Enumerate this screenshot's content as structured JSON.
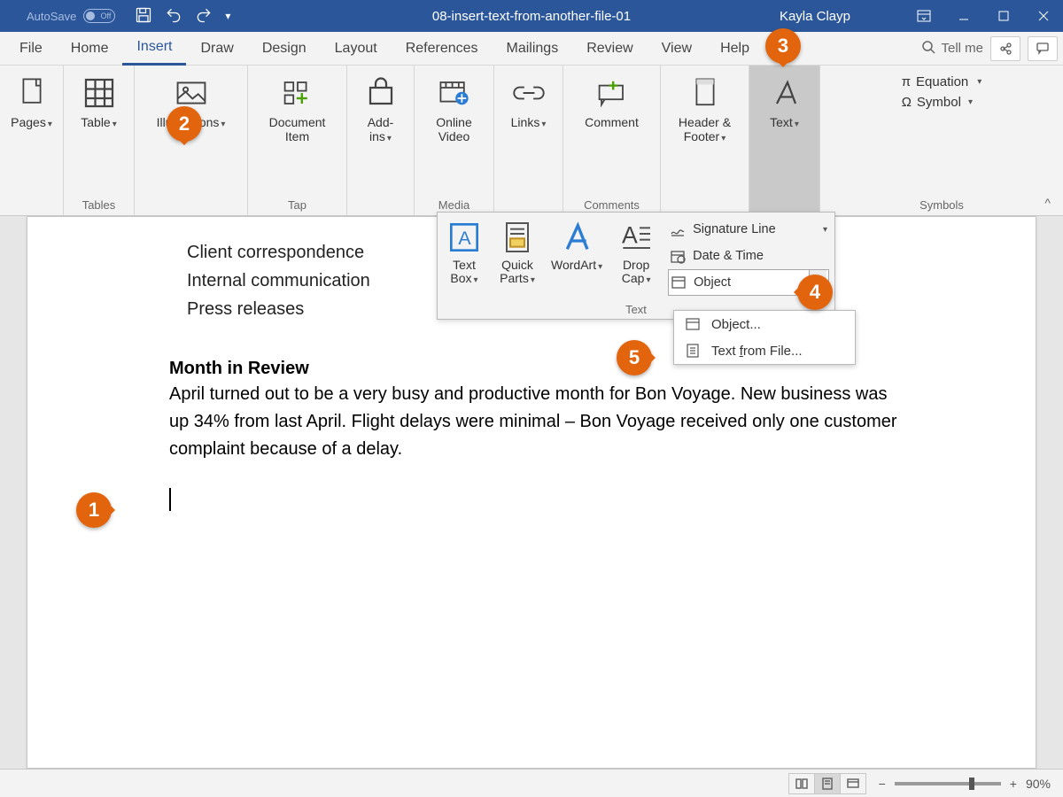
{
  "titlebar": {
    "autosave_label": "AutoSave",
    "autosave_state": "Off",
    "document_title": "08-insert-text-from-another-file-01",
    "username": "Kayla Clayp"
  },
  "tabs": {
    "file": "File",
    "home": "Home",
    "insert": "Insert",
    "draw": "Draw",
    "design": "Design",
    "layout": "Layout",
    "references": "References",
    "mailings": "Mailings",
    "review": "Review",
    "view": "View",
    "help": "Help",
    "tellme": "Tell me"
  },
  "ribbon": {
    "pages": {
      "label": "Pages",
      "group": ""
    },
    "table": {
      "label": "Table",
      "group": "Tables"
    },
    "illustrations": {
      "label": "Illustrations"
    },
    "document_item": {
      "label": "Document\nItem",
      "group": "Tap"
    },
    "addins": {
      "label": "Add-\nins"
    },
    "online_video": {
      "label": "Online\nVideo",
      "group": "Media"
    },
    "links": {
      "label": "Links"
    },
    "comment": {
      "label": "Comment",
      "group": "Comments"
    },
    "header_footer": {
      "label": "Header &\nFooter"
    },
    "text": {
      "label": "Text"
    },
    "equation": "Equation",
    "symbol": "Symbol",
    "symbols_group": "Symbols"
  },
  "text_panel": {
    "textbox": "Text\nBox",
    "quickparts": "Quick\nParts",
    "wordart": "WordArt",
    "dropcap": "Drop\nCap",
    "signature": "Signature Line",
    "datetime": "Date & Time",
    "object": "Object",
    "group_label": "Text"
  },
  "submenu": {
    "object": "Object...",
    "text_from_file_prefix": "Text ",
    "text_from_file_underline": "f",
    "text_from_file_suffix": "rom File..."
  },
  "document": {
    "line1": "Client correspondence",
    "line2": "Internal communication",
    "line3": "Press releases",
    "heading": "Month in Review",
    "paragraph": "April turned out to be a very busy and productive month for Bon Voyage. New business was up 34% from last April. Flight delays were minimal – Bon Voyage received only one customer complaint because of a delay."
  },
  "status": {
    "zoom": "90%"
  },
  "callouts": {
    "c1": "1",
    "c2": "2",
    "c3": "3",
    "c4": "4",
    "c5": "5"
  }
}
